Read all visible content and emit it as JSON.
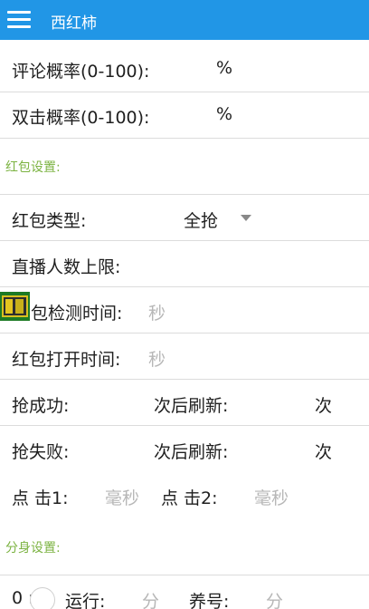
{
  "app_title": "西红柿",
  "comment_prob_label": "评论概率(0-100):",
  "comment_prob_unit": "%",
  "double_click_prob_label": "双击概率(0-100):",
  "double_click_prob_unit": "%",
  "redpacket_section": "红包设置:",
  "redpacket_type_label": "红包类型:",
  "redpacket_type_value": "全抢",
  "live_limit_label": "直播人数上限:",
  "detect_time_label": "包检测时间:",
  "detect_time_hint": "秒",
  "open_time_label": "红包打开时间:",
  "open_time_hint": "秒",
  "grab_success_label": "抢成功:",
  "grab_success_refresh_label": "次后刷新:",
  "grab_success_unit": "次",
  "grab_fail_label": "抢失败:",
  "grab_fail_refresh_label": "次后刷新:",
  "grab_fail_unit": "次",
  "click1_label": "点 击1:",
  "click1_hint": "毫秒",
  "click2_label": "点 击2:",
  "click2_hint": "毫秒",
  "clone_section": "分身设置:",
  "clone_index": "0 :",
  "clone_run_label": "运行:",
  "clone_run_hint": "分",
  "clone_raise_label": "养号:",
  "clone_raise_hint": "分"
}
